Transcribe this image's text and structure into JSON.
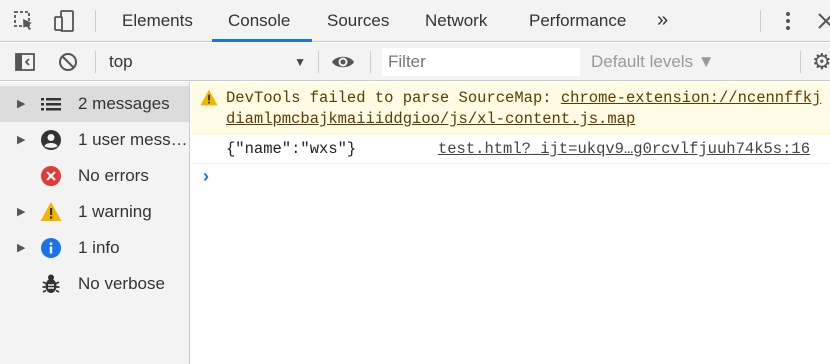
{
  "tabs": [
    "Elements",
    "Console",
    "Sources",
    "Network",
    "Performance"
  ],
  "active_tab": "Console",
  "more_tabs_glyph": "»",
  "toolbar": {
    "context": "top",
    "filter_placeholder": "Filter",
    "levels": "Default levels ▼"
  },
  "sidebar": {
    "items": [
      {
        "label": "2 messages",
        "icon": "list-icon",
        "expandable": true,
        "selected": true
      },
      {
        "label": "1 user mess…",
        "icon": "user-icon",
        "expandable": true,
        "selected": false
      },
      {
        "label": "No errors",
        "icon": "error-icon",
        "expandable": false,
        "selected": false
      },
      {
        "label": "1 warning",
        "icon": "warning-icon",
        "expandable": true,
        "selected": false
      },
      {
        "label": "1 info",
        "icon": "info-icon",
        "expandable": true,
        "selected": false
      },
      {
        "label": "No verbose",
        "icon": "bug-icon",
        "expandable": false,
        "selected": false
      }
    ]
  },
  "messages": {
    "warning_prefix": "DevTools failed to parse SourceMap: ",
    "warning_url": "chrome-extension://ncennffkjdiamlpmcbajkmaiiiddgioo/js/xl-content.js.map",
    "log_text": "{\"name\":\"wxs\"}",
    "log_source": "test.html?_ijt=ukqv9…g0rcvlfjuuh74k5s:16"
  },
  "prompt_glyph": "›",
  "colors": {
    "accent": "#1a73e8",
    "warning_bg": "#fffbe5",
    "warning_text": "#5c3c00",
    "error": "#e53935",
    "warning_icon": "#f4b400",
    "info": "#1a73e8"
  }
}
